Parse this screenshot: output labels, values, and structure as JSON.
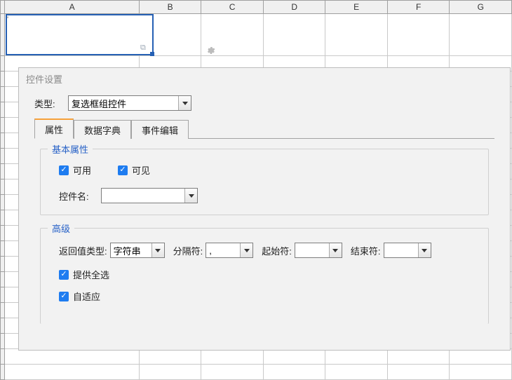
{
  "columns": [
    "A",
    "B",
    "C",
    "D",
    "E",
    "F",
    "G"
  ],
  "panel": {
    "title": "控件设置",
    "type_label": "类型:",
    "type_value": "复选框组控件",
    "tabs": [
      "属性",
      "数据字典",
      "事件编辑"
    ],
    "active_tab": 0
  },
  "basic": {
    "legend": "基本属性",
    "enabled_label": "可用",
    "visible_label": "可见",
    "name_label": "控件名:",
    "name_value": ""
  },
  "advanced": {
    "legend": "高级",
    "return_type_label": "返回值类型:",
    "return_type_value": "字符串",
    "sep_label": "分隔符:",
    "sep_value": ",",
    "start_label": "起始符:",
    "start_value": "",
    "end_label": "结束符:",
    "end_value": "",
    "select_all_label": "提供全选",
    "adaptive_label": "自适应"
  }
}
